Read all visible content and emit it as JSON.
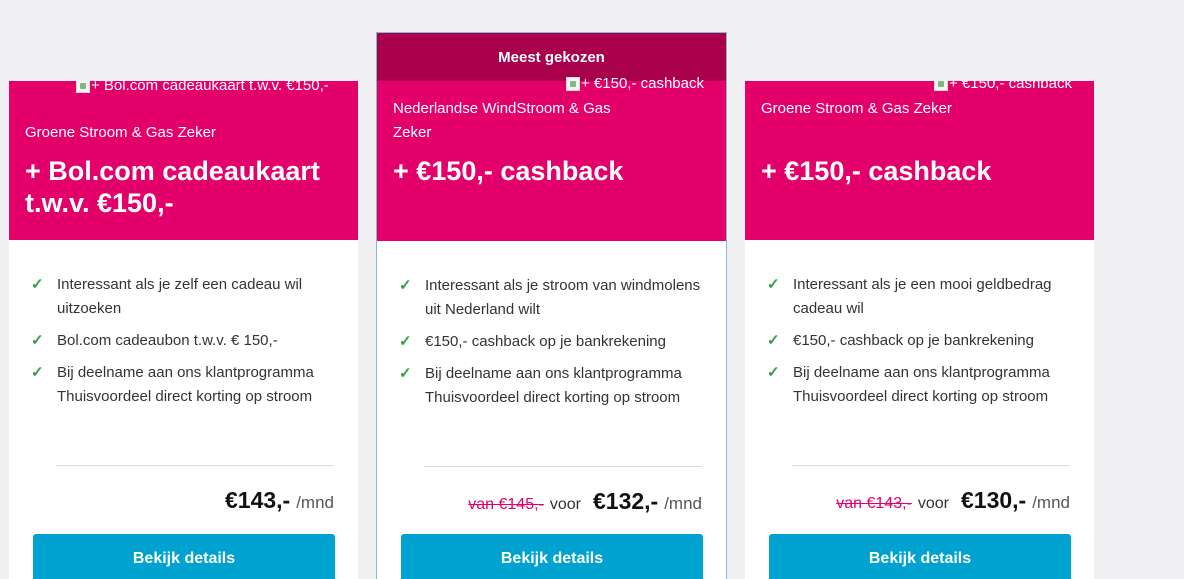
{
  "plans": [
    {
      "image_alt": "+ Bol.com cadeaukaart t.w.v. €150,-",
      "product": "Groene Stroom & Gas Zeker",
      "promo": "+ Bol.com cadeaukaart t.w.v. €150,-",
      "usps": [
        "Interessant als je zelf een cadeau wil uitzoeken",
        "Bol.com cadeaubon t.w.v. € 150,-",
        "Bij deelname aan ons klantprogramma Thuisvoordeel direct korting op stroom"
      ],
      "price": "€143,-",
      "unit": "/mnd",
      "button": "Bekijk details"
    },
    {
      "ribbon": "Meest gekozen",
      "image_alt": "+ €150,- cashback",
      "product": "Nederlandse WindStroom & Gas Zeker",
      "promo": "+ €150,- cashback",
      "usps": [
        "Interessant als je stroom van windmolens uit Nederland wilt",
        "€150,- cashback op je bankrekening",
        "Bij deelname aan ons klantprogramma Thuisvoordeel direct korting op stroom"
      ],
      "old_price": "van €145,-",
      "voor": "voor",
      "price": "€132,-",
      "unit": "/mnd",
      "button": "Bekijk details"
    },
    {
      "image_alt": "+ €150,- cashback",
      "product": "Groene Stroom & Gas Zeker",
      "promo": "+ €150,- cashback",
      "usps": [
        "Interessant als je een mooi geldbedrag cadeau wil",
        "€150,- cashback op je bankrekening",
        "Bij deelname aan ons klantprogramma Thuisvoordeel direct korting op stroom"
      ],
      "old_price": "van €143,-",
      "voor": "voor",
      "price": "€130,-",
      "unit": "/mnd",
      "button": "Bekijk details"
    }
  ],
  "check_icon": "✓",
  "colors": {
    "header_pink": "#e3006a",
    "ribbon_dark": "#a8004a",
    "button_blue": "#00a3cf",
    "check_green": "#2e9e3e"
  }
}
